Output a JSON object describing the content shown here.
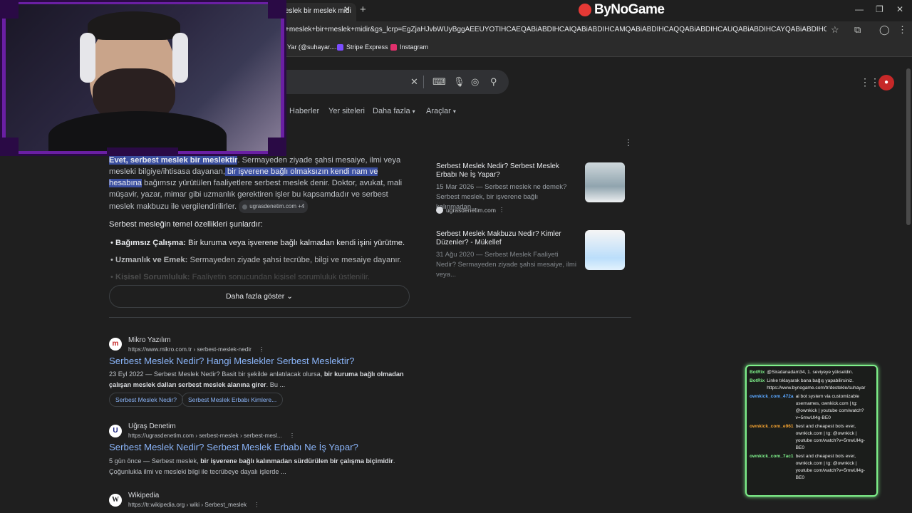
{
  "browser": {
    "tab_title": "eslek bir meslek midi",
    "brand": "ByNoGame",
    "url": "+meslek+bir+meslek+midir&gs_lcrp=EgZjaHJvbWUyBggAEEUYOTIHCAEQABiABDIHCAIQABiABDIHCAMQABiABDIHCAQQABiABDIHCAUQABiABDIHCAYQABiABDIHCAcQABiABDIHCA...",
    "bookmarks": [
      "Yar (@suhayar....",
      "Stripe Express",
      "Instagram"
    ],
    "colors": {
      "accent": "#8ab4f8",
      "brand_red": "#e53935",
      "chat_border": "#7ef08a"
    }
  },
  "search": {
    "tabs": [
      "Haberler",
      "Yer siteleri",
      "Daha fazla",
      "Araçlar"
    ]
  },
  "answer": {
    "lead_highlight": "Evet, serbest meslek bir meslektir",
    "p1": ". Sermayeden ziyade şahsi mesaiye, ilmi veya mesleki bilgiye/ihtisasa dayanan,",
    "p1_highlight": " bir işverene bağlı olmaksızın kendi nam ve hesabına",
    "p2": " bağımsız yürütülen faaliyetlere serbest meslek denir. Doktor, avukat, mali müşavir, yazar, mimar gibi uzmanlık gerektiren işler bu kapsamdadır ve serbest meslek makbuzu ile vergilendirilirler.",
    "source_chip": "ugrasdenetim.com +4",
    "intro": "Serbest mesleğin temel özellikleri şunlardır:",
    "bullets": [
      {
        "bold": "Bağımsız Çalışma:",
        "text": " Bir kuruma veya işverene bağlı kalmadan kendi işini yürütme."
      },
      {
        "bold": "Uzmanlık ve Emek:",
        "text": " Sermayeden ziyade şahsi tecrübe, bilgi ve mesaiye dayanır."
      },
      {
        "bold": "Kişisel Sorumluluk:",
        "text": " Faaliyetin sonucundan kişisel sorumluluk üstlenilir."
      }
    ],
    "more_button": "Daha fazla göster"
  },
  "side_cards": [
    {
      "title": "Serbest Meslek Nedir? Serbest Meslek Erbabı Ne İş Yapar?",
      "meta": "15 Mar 2026 — Serbest meslek ne demek? Serbest meslek, bir işverene bağlı kalınmadan...",
      "source": "ugrasdenetim.com"
    },
    {
      "title": "Serbest Meslek Makbuzu Nedir? Kimler Düzenler? - Mükellef",
      "meta": "31 Ağu 2020 — Serbest Meslek Faaliyeti Nedir? Sermayeden ziyade şahsi mesaiye, ilmi veya...",
      "source": ""
    }
  ],
  "results": [
    {
      "site": "Mikro Yazılım",
      "url": "https://www.mikro.com.tr › serbest-meslek-nedir",
      "title": "Serbest Meslek Nedir? Hangi Meslekler Serbest Meslektir?",
      "snippet_a": "23 Eyl 2022 — Serbest Meslek Nedir? Basit bir şekilde anlatılacak olursa, ",
      "snippet_b": "bir kuruma bağlı olmadan çalışan meslek dalları serbest meslek alanına girer",
      "snippet_c": ". Bu ...",
      "pills": [
        "Serbest Meslek Nedir?",
        "Serbest Meslek Erbabı Kimlere..."
      ]
    },
    {
      "site": "Uğraş Denetim",
      "url": "https://ugrasdenetim.com › serbest-meslek › serbest-mesl...",
      "title": "Serbest Meslek Nedir? Serbest Meslek Erbabı Ne İş Yapar?",
      "snippet_a": "5 gün önce — Serbest meslek, ",
      "snippet_b": "bir işverene bağlı kalınmadan sürdürülen bir çalışma biçimidir",
      "snippet_c": ". Çoğunlukla ilmi ve mesleki bilgi ile tecrübeye dayalı işlerde ..."
    },
    {
      "site": "Wikipedia",
      "url": "https://tr.wikipedia.org › wiki › Serbest_meslek"
    }
  ],
  "chat": [
    {
      "user": "BotRix",
      "color": "#7ef08a",
      "msg": "@Siradanadam34, 1. seviyeye yükseldin."
    },
    {
      "user": "BotRix",
      "color": "#7ef08a",
      "msg": "Linke tıklayarak bana bağış yapabilirsiniz. https://www.bynogame.com/tr/destekle/suhayar"
    },
    {
      "user": "ownkick_com_472a",
      "color": "#5aa7ff",
      "msg": "ai bot system via customizable usernames, ownkick.com | tg: @ownkick | youtube com/watch?v=5mwUl4g-BE0"
    },
    {
      "user": "ownkick_com_e961",
      "color": "#f0a030",
      "msg": "best and cheapest bots ever, ownkick.com | tg: @ownkick | youtube com/watch?v=5mwUl4g-BE0"
    },
    {
      "user": "ownkick_com_7ac1",
      "color": "#7ef08a",
      "msg": "best and cheapest bots ever, ownkick.com | tg: @ownkick | youtube com/watch?v=5mwUl4g-BE0"
    }
  ]
}
